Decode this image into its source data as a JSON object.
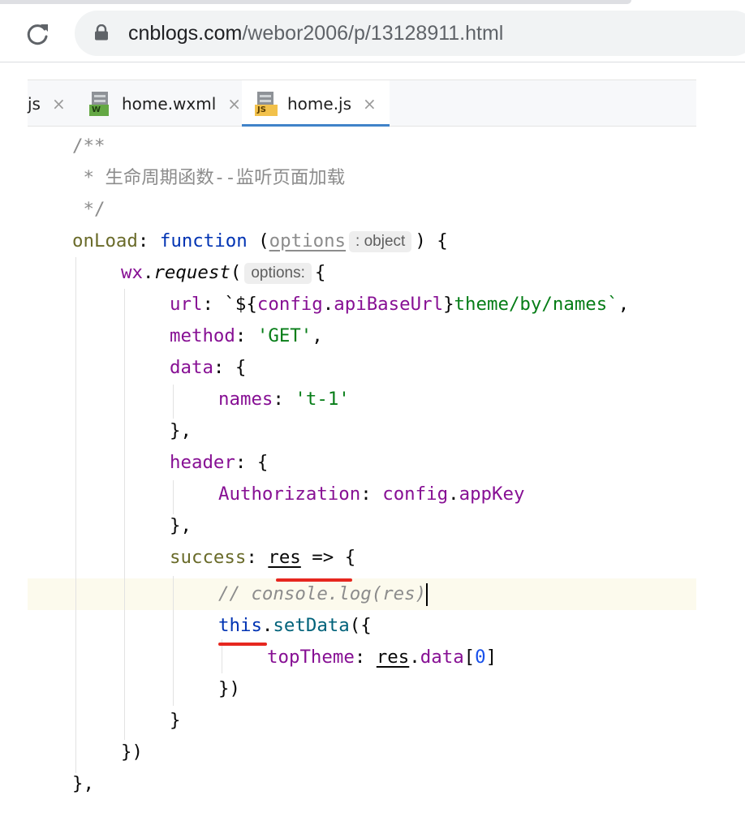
{
  "browser": {
    "url_host": "cnblogs.com",
    "url_path": "/webor2006/p/13128911.html",
    "reload_icon": "reload-icon",
    "lock_icon": "lock-icon"
  },
  "ide": {
    "tabs": [
      {
        "label": "js",
        "close": "×"
      },
      {
        "label": "home.wxml",
        "close": "×",
        "icon_badge": "W"
      },
      {
        "label": "home.js",
        "close": "×",
        "icon_badge": "JS",
        "active": true
      }
    ],
    "code": {
      "l1": "/**",
      "l2": " * 生命周期函数--监听页面加载",
      "l3": " */",
      "l4_onload": "onLoad",
      "l4_colon": ": ",
      "l4_function": "function",
      "l4_paren": " (",
      "l4_options": "options",
      "l4_hint": ": object",
      "l4_end": ") {",
      "l5_wx": "wx",
      "l5_dot": ".",
      "l5_request": "request",
      "l5_paren": "(",
      "l5_hint": "options:",
      "l5_brace": "{",
      "l6_url": "url",
      "l6_colon": ": ",
      "l6_tick": "`${",
      "l6_config": "config",
      "l6_dot": ".",
      "l6_api": "apiBaseUrl",
      "l6_close": "}",
      "l6_path": "theme/by/names`",
      "l6_comma": ",",
      "l7_method": "method",
      "l7_colon": ": ",
      "l7_val": "'GET'",
      "l7_comma": ",",
      "l8_data": "data",
      "l8_rest": ": {",
      "l9_names": "names",
      "l9_colon": ": ",
      "l9_val": "'t-1'",
      "l10": "},",
      "l11_header": "header",
      "l11_rest": ": {",
      "l12_auth": "Authorization",
      "l12_colon": ": ",
      "l12_config": "config",
      "l12_dot": ".",
      "l12_key": "appKey",
      "l13": "},",
      "l14_success": "success",
      "l14_colon": ": ",
      "l14_res": "res",
      "l14_arrow": " => {",
      "l15_comment": "// console.log(res)",
      "l16_this": "this",
      "l16_dot": ".",
      "l16_set": "setData",
      "l16_rest": "({",
      "l17_top": "topTheme",
      "l17_colon": ": ",
      "l17_res": "res",
      "l17_dot": ".",
      "l17_data": "data",
      "l17_open": "[",
      "l17_num": "0",
      "l17_close": "]",
      "l18": "})",
      "l19": "}",
      "l20": "})",
      "l21": "},"
    }
  },
  "colors": {
    "keyword": "#0033b3",
    "property": "#871094",
    "string": "#067d17",
    "comment": "#8c8c8c",
    "annotation_mark": "#e6271f",
    "tab_underline": "#4083c9"
  }
}
